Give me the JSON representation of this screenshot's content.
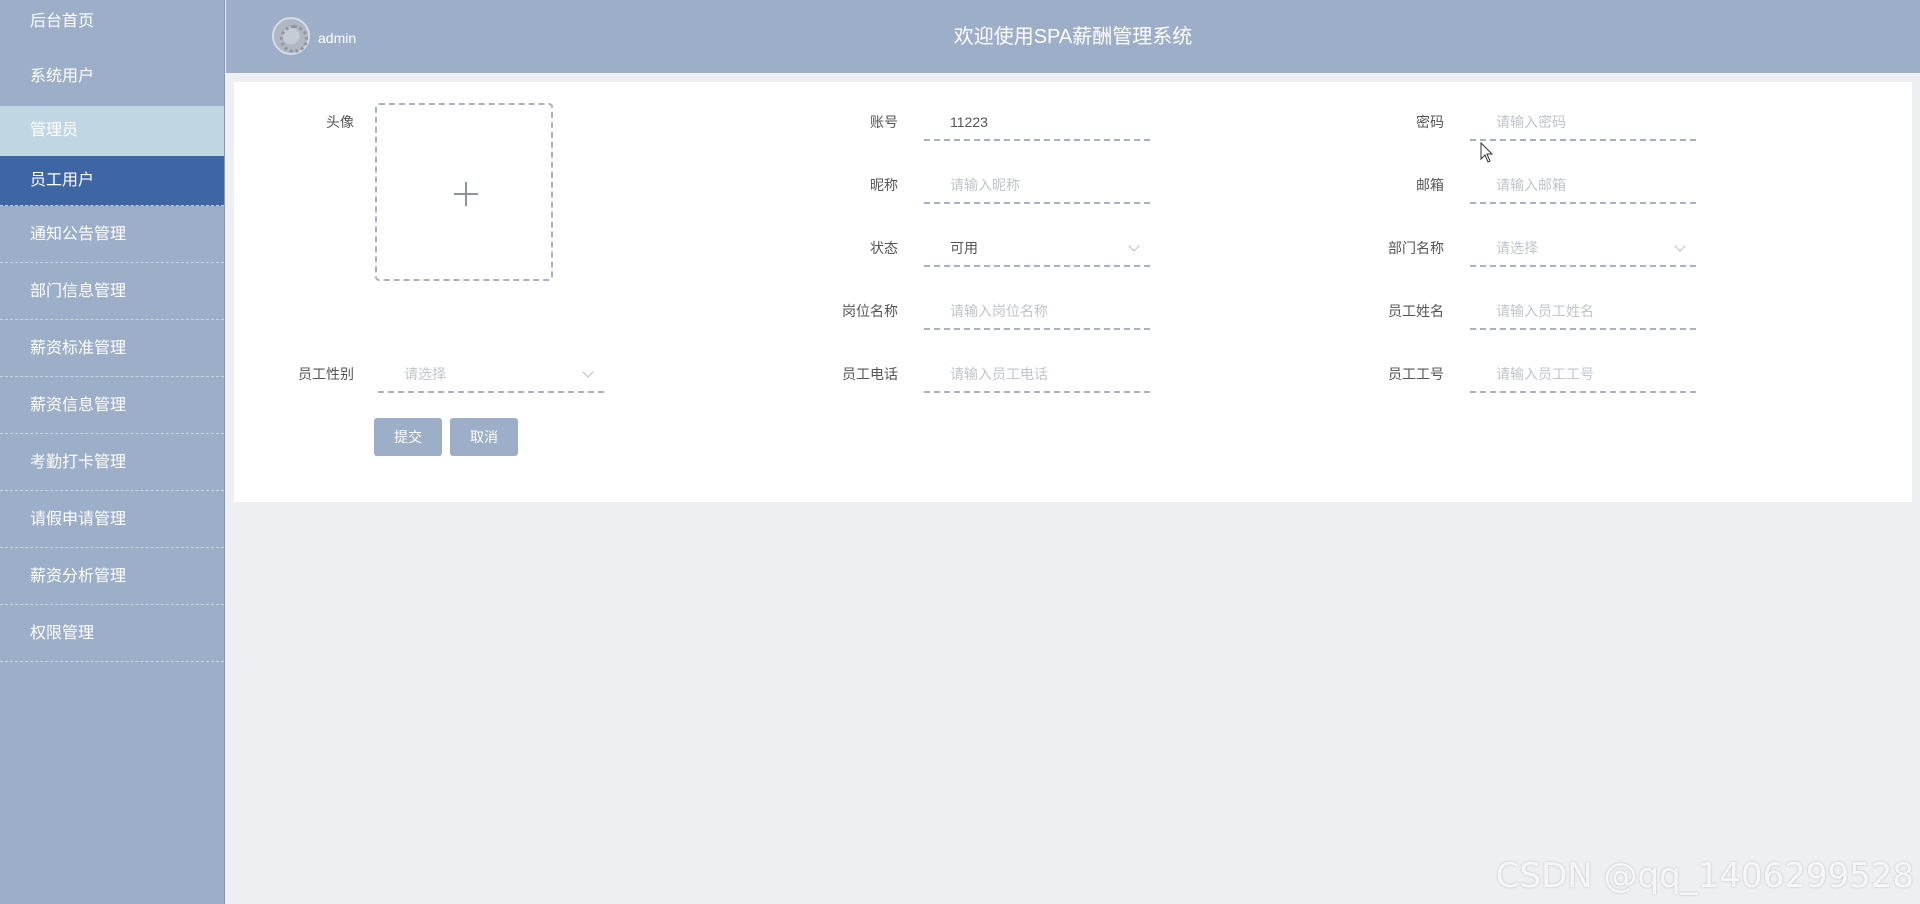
{
  "header": {
    "username": "admin",
    "title": "欢迎使用SPA薪酬管理系统"
  },
  "sidebar": {
    "items": [
      {
        "label": "后台首页"
      },
      {
        "label": "系统用户"
      },
      {
        "label": "管理员"
      },
      {
        "label": "员工用户"
      },
      {
        "label": "通知公告管理"
      },
      {
        "label": "部门信息管理"
      },
      {
        "label": "薪资标准管理"
      },
      {
        "label": "薪资信息管理"
      },
      {
        "label": "考勤打卡管理"
      },
      {
        "label": "请假申请管理"
      },
      {
        "label": "薪资分析管理"
      },
      {
        "label": "权限管理"
      }
    ]
  },
  "form": {
    "avatar_label": "头像",
    "account": {
      "label": "账号",
      "value": "11223"
    },
    "password": {
      "label": "密码",
      "placeholder": "请输入密码"
    },
    "nickname": {
      "label": "昵称",
      "placeholder": "请输入昵称"
    },
    "email": {
      "label": "邮箱",
      "placeholder": "请输入邮箱"
    },
    "status": {
      "label": "状态",
      "value": "可用"
    },
    "department": {
      "label": "部门名称",
      "placeholder": "请选择"
    },
    "position": {
      "label": "岗位名称",
      "placeholder": "请输入岗位名称"
    },
    "employee_name": {
      "label": "员工姓名",
      "placeholder": "请输入员工姓名"
    },
    "gender": {
      "label": "员工性别",
      "placeholder": "请选择"
    },
    "phone": {
      "label": "员工电话",
      "placeholder": "请输入员工电话"
    },
    "employee_no": {
      "label": "员工工号",
      "placeholder": "请输入员工工号"
    },
    "submit_label": "提交",
    "cancel_label": "取消"
  },
  "watermark": "CSDN @qq_1406299528",
  "colors": {
    "sidebar_bg": "#9daec8",
    "active_item": "#3f66a4",
    "hover_item": "#c0d7e3",
    "content_bg": "#eeeff3"
  }
}
